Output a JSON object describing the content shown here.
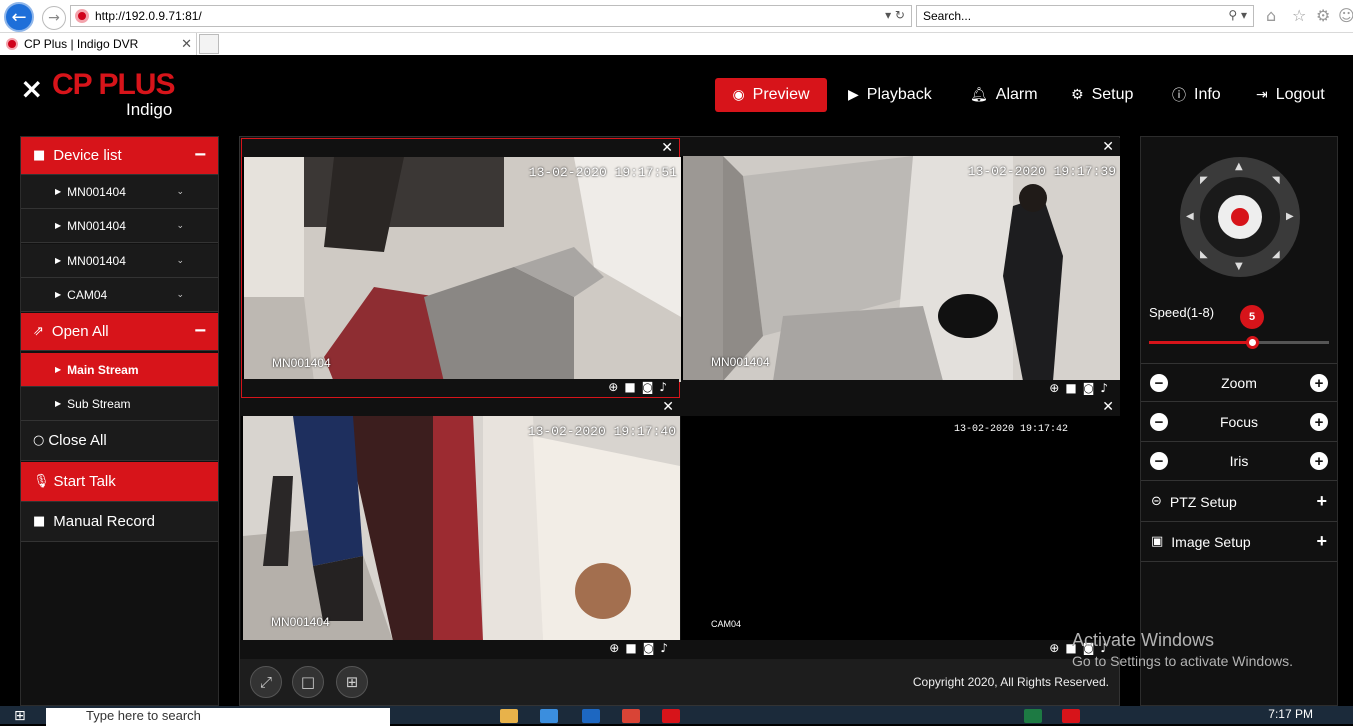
{
  "browser": {
    "url": "http://192.0.9.71:81/",
    "search_placeholder": "Search...",
    "tab_title": "CP Plus | Indigo DVR"
  },
  "brand": {
    "name": "CP PLUS",
    "sub": "Indigo",
    "accent": "#d7141a"
  },
  "nav": [
    {
      "label": "Preview",
      "icon": "eye-icon",
      "active": true
    },
    {
      "label": "Playback",
      "icon": "play-circle-icon"
    },
    {
      "label": "Alarm",
      "icon": "bell-icon"
    },
    {
      "label": "Setup",
      "icon": "gear-icon"
    },
    {
      "label": "Info",
      "icon": "info-icon"
    },
    {
      "label": "Logout",
      "icon": "logout-icon"
    }
  ],
  "sidebar": {
    "device_list": "Device list",
    "devices": [
      "MN001404",
      "MN001404",
      "MN001404",
      "CAM04"
    ],
    "open_all": "Open All",
    "streams": [
      "Main Stream",
      "Sub Stream"
    ],
    "close_all": "Close All",
    "start_talk": "Start Talk",
    "manual_record": "Manual Record"
  },
  "cameras": [
    {
      "timestamp": "13-02-2020 19:17:51",
      "label": "MN001404"
    },
    {
      "timestamp": "13-02-2020 19:17:39",
      "label": "MN001404"
    },
    {
      "timestamp": "13-02-2020 19:17:40",
      "label": "MN001404"
    },
    {
      "timestamp": "13-02-2020 19:17:42",
      "label": "CAM04"
    }
  ],
  "footer": {
    "copyright": "Copyright 2020, All Rights Reserved."
  },
  "ptz": {
    "speed_label": "Speed(1-8)",
    "speed_value": "5",
    "speed_fraction": 0.57,
    "zoom": "Zoom",
    "focus": "Focus",
    "iris": "Iris",
    "ptz_setup": "PTZ Setup",
    "image_setup": "Image Setup"
  },
  "watermark": {
    "title": "Activate Windows",
    "sub": "Go to Settings to activate Windows."
  },
  "taskbar": {
    "search_placeholder": "Type here to search",
    "time": "7:17 PM"
  }
}
